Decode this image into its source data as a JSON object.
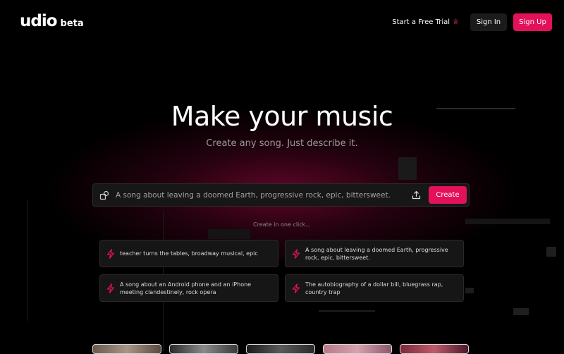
{
  "header": {
    "logo_text": "udio",
    "logo_badge": "beta",
    "trial_label": "Start a Free Trial",
    "sign_in_label": "Sign In",
    "sign_up_label": "Sign Up"
  },
  "hero": {
    "title": "Make your music",
    "subtitle": "Create any song. Just describe it."
  },
  "prompt": {
    "placeholder": "A song about leaving a doomed Earth, progressive rock, epic, bittersweet.",
    "create_label": "Create"
  },
  "suggestions": {
    "heading": "Create in one click...",
    "items": [
      {
        "text": "teacher turns the tables, broadway musical, epic"
      },
      {
        "text": "A song about leaving a doomed Earth, progressive rock, epic, bittersweet."
      },
      {
        "text": "A song about an Android phone and an iPhone meeting clandestinely, rock opera"
      },
      {
        "text": "The autobiography of a dollar bill, bluegrass rap, country trap"
      }
    ]
  },
  "colors": {
    "accent": "#e3105a",
    "background": "#000000",
    "card": "#161616"
  },
  "icons": {
    "prompt_left": "shapes-icon",
    "prompt_right": "upload-icon",
    "suggestion": "lightning-bolt-icon",
    "trial": "crown-icon"
  }
}
